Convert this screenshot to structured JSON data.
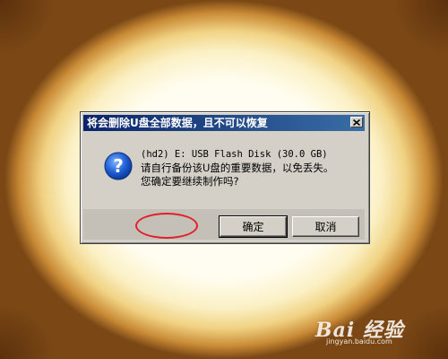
{
  "dialog": {
    "title": "将会删除U盘全部数据，且不可以恢复",
    "close_glyph": "✕",
    "message_line1": "(hd2) E: USB Flash Disk (30.0 GB)",
    "message_line2": "请自行备份该U盘的重要数据，以免丢失。",
    "message_line3": "您确定要继续制作吗?",
    "ok_label": "确定",
    "cancel_label": "取消"
  },
  "icons": {
    "question": "question-icon",
    "close": "close-icon"
  },
  "annotation": {
    "highlight_color": "#e0202a"
  },
  "watermark": {
    "logo_text": "Bai 经验",
    "url": "jingyan.baidu.com"
  }
}
